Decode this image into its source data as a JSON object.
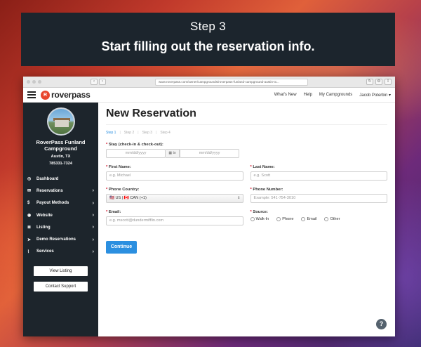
{
  "banner": {
    "step": "Step 3",
    "subtitle": "Start filling out the reservation info."
  },
  "browser": {
    "url": "www.roverpass.com/owner/campgrounds/roverpass-funland-campground-austin-tx..."
  },
  "topnav": {
    "logo_mark": "R",
    "logo_text": "roverpass",
    "links": [
      "What's New",
      "Help",
      "My Campgrounds",
      "Jacob Poterbin ▾"
    ]
  },
  "sidebar": {
    "camp_name": "RoverPass Funland Campground",
    "location": "Austin, TX",
    "phone": "785331-7324",
    "items": [
      {
        "label": "Dashboard",
        "icon": "dashboard-icon",
        "glyph": "◎",
        "chevron": ""
      },
      {
        "label": "Reservations",
        "icon": "envelope-icon",
        "glyph": "✉",
        "chevron": "›"
      },
      {
        "label": "Payout Methods",
        "icon": "dollar-icon",
        "glyph": "$",
        "chevron": "›"
      },
      {
        "label": "Website",
        "icon": "globe-icon",
        "glyph": "◉",
        "chevron": "›"
      },
      {
        "label": "Listing",
        "icon": "list-icon",
        "glyph": "≣",
        "chevron": "›"
      },
      {
        "label": "Demo Reservations",
        "icon": "paper-plane-icon",
        "glyph": "➤",
        "chevron": "›"
      },
      {
        "label": "Services",
        "icon": "chart-icon",
        "glyph": "⌇",
        "chevron": "›"
      }
    ],
    "view_listing": "View Listing",
    "contact_support": "Contact Support"
  },
  "main": {
    "title": "New Reservation",
    "steps": [
      "Step 1",
      "Step 2",
      "Step 3",
      "Step 4"
    ],
    "stay_label": "Stay (check-in & check-out):",
    "date_placeholder": "mm/dd/yyyy",
    "to_label": "to",
    "first_name_label": "First Name:",
    "first_name_placeholder": "e.g. Michael",
    "last_name_label": "Last Name:",
    "last_name_placeholder": "e.g. Scott",
    "country_label": "Phone Country:",
    "country_value": "🇺🇸 US | 🇨🇦 CAN (+1)",
    "phone_label": "Phone Number:",
    "phone_placeholder": "Example: 541-754-3010",
    "email_label": "Email:",
    "email_placeholder": "e.g. mscott@dundermifflin.com",
    "source_label": "Source:",
    "sources": [
      "Walk-In",
      "Phone",
      "Email",
      "Other"
    ],
    "continue": "Continue",
    "help": "?"
  },
  "colors": {
    "accent": "#2b8fe0",
    "sidebar": "#1d252c",
    "banner": "#1c252d",
    "brand": "#e8452c"
  }
}
